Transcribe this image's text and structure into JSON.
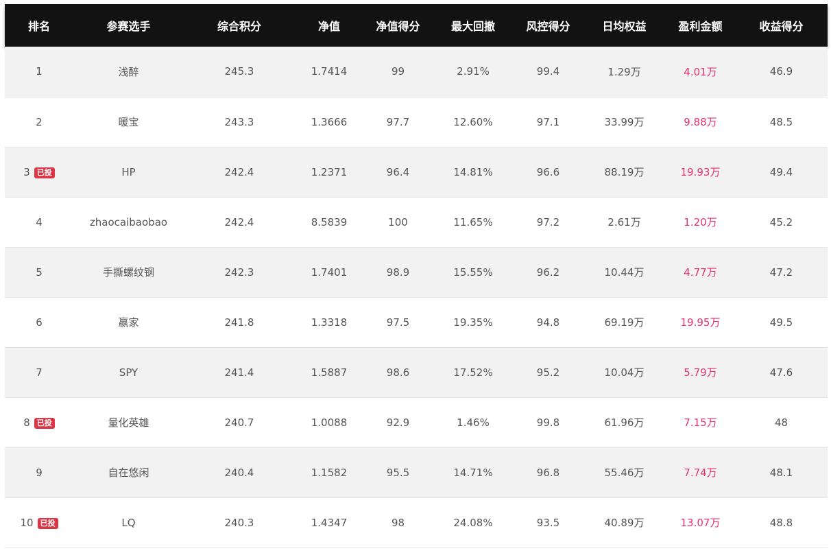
{
  "columns": [
    "排名",
    "参赛选手",
    "综合积分",
    "净值",
    "净值得分",
    "最大回撤",
    "风控得分",
    "日均权益",
    "盈利金额",
    "收益得分"
  ],
  "colors": {
    "header_bg": "#121212",
    "profit": "#e5316b",
    "badge": "#dc3545",
    "row_alt": "#f2f2f2"
  },
  "rows": [
    {
      "rank": "1",
      "badge": "",
      "player": "浅醉",
      "score": "245.3",
      "nav": "1.7414",
      "nav_score": "99",
      "max_drawdown": "2.91%",
      "risk_score": "99.4",
      "avg_equity": "1.29万",
      "profit": "4.01万",
      "return_score": "46.9"
    },
    {
      "rank": "2",
      "badge": "",
      "player": "暖宝",
      "score": "243.3",
      "nav": "1.3666",
      "nav_score": "97.7",
      "max_drawdown": "12.60%",
      "risk_score": "97.1",
      "avg_equity": "33.99万",
      "profit": "9.88万",
      "return_score": "48.5"
    },
    {
      "rank": "3",
      "badge": "已投",
      "player": "HP",
      "score": "242.4",
      "nav": "1.2371",
      "nav_score": "96.4",
      "max_drawdown": "14.81%",
      "risk_score": "96.6",
      "avg_equity": "88.19万",
      "profit": "19.93万",
      "return_score": "49.4"
    },
    {
      "rank": "4",
      "badge": "",
      "player": "zhaocaibaobao",
      "score": "242.4",
      "nav": "8.5839",
      "nav_score": "100",
      "max_drawdown": "11.65%",
      "risk_score": "97.2",
      "avg_equity": "2.61万",
      "profit": "1.20万",
      "return_score": "45.2"
    },
    {
      "rank": "5",
      "badge": "",
      "player": "手撕螺纹钢",
      "score": "242.3",
      "nav": "1.7401",
      "nav_score": "98.9",
      "max_drawdown": "15.55%",
      "risk_score": "96.2",
      "avg_equity": "10.44万",
      "profit": "4.77万",
      "return_score": "47.2"
    },
    {
      "rank": "6",
      "badge": "",
      "player": "赢家",
      "score": "241.8",
      "nav": "1.3318",
      "nav_score": "97.5",
      "max_drawdown": "19.35%",
      "risk_score": "94.8",
      "avg_equity": "69.19万",
      "profit": "19.95万",
      "return_score": "49.5"
    },
    {
      "rank": "7",
      "badge": "",
      "player": "SPY",
      "score": "241.4",
      "nav": "1.5887",
      "nav_score": "98.6",
      "max_drawdown": "17.52%",
      "risk_score": "95.2",
      "avg_equity": "10.04万",
      "profit": "5.79万",
      "return_score": "47.6"
    },
    {
      "rank": "8",
      "badge": "已投",
      "player": "量化英雄",
      "score": "240.7",
      "nav": "1.0088",
      "nav_score": "92.9",
      "max_drawdown": "1.46%",
      "risk_score": "99.8",
      "avg_equity": "61.96万",
      "profit": "7.15万",
      "return_score": "48"
    },
    {
      "rank": "9",
      "badge": "",
      "player": "自在悠闲",
      "score": "240.4",
      "nav": "1.1582",
      "nav_score": "95.5",
      "max_drawdown": "14.71%",
      "risk_score": "96.8",
      "avg_equity": "55.46万",
      "profit": "7.74万",
      "return_score": "48.1"
    },
    {
      "rank": "10",
      "badge": "已投",
      "player": "LQ",
      "score": "240.3",
      "nav": "1.4347",
      "nav_score": "98",
      "max_drawdown": "24.08%",
      "risk_score": "93.5",
      "avg_equity": "40.89万",
      "profit": "13.07万",
      "return_score": "48.8"
    }
  ]
}
